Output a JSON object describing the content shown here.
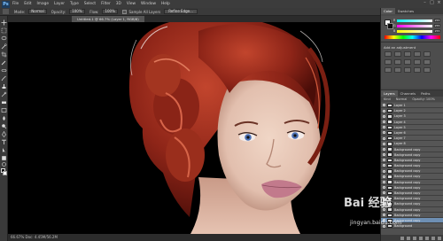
{
  "app": {
    "logo_text": "Ps"
  },
  "menu": [
    "File",
    "Edit",
    "Image",
    "Layer",
    "Type",
    "Select",
    "Filter",
    "3D",
    "View",
    "Window",
    "Help"
  ],
  "options_bar": {
    "mode_label": "Mode:",
    "mode_value": "Normal",
    "opacity_label": "Opacity:",
    "opacity_value": "100%",
    "flow_label": "Flow:",
    "flow_value": "100%",
    "sample_label": "Sample All Layers",
    "button_label": "Refine Edge..."
  },
  "document": {
    "tab_label": "Untitled-1 @ 66.7% (Layer 1, RGB/8)",
    "status_text": "66.67%   Doc: 4.45M/56.2M"
  },
  "panels": {
    "color_tabs": [
      "Color",
      "Swatches"
    ],
    "color_sliders": [
      {
        "label": "R",
        "value": "255"
      },
      {
        "label": "G",
        "value": "255"
      },
      {
        "label": "B",
        "value": "255"
      }
    ],
    "adjustments_title": "Add an adjustment",
    "layers_tabs": [
      "Layers",
      "Channels",
      "Paths"
    ],
    "layers_options": [
      "Kind",
      "Normal",
      "Opacity: 100%"
    ],
    "layers": [
      "Layer 1",
      "Layer 2",
      "Layer 3",
      "Layer 4",
      "Layer 5",
      "Layer 6",
      "Layer 7",
      "Layer 8",
      "Background copy",
      "Background copy",
      "Background copy",
      "Background copy",
      "Background copy",
      "Background copy",
      "Background copy",
      "Background copy",
      "Background copy",
      "Background copy",
      "Background copy",
      "Background copy",
      "Background copy",
      "Background copy",
      "Background"
    ],
    "selected_layer_index": 21
  },
  "watermark": {
    "logo": "Bai 经验",
    "url": "jingyan.baidu.com"
  },
  "colors": {
    "hair": "#9b2f1f",
    "skin": "#e6c7b5",
    "lips": "#c27a8c",
    "eyes": "#4b6fb3"
  }
}
